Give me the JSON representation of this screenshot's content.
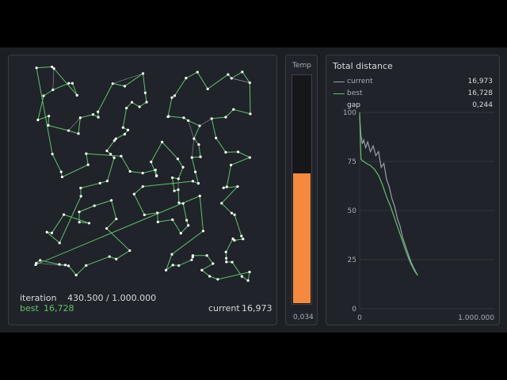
{
  "tsp": {
    "iteration_label": "iteration",
    "iteration_value": "430.500 / 1.000.000",
    "best_label": "best",
    "best_value": "16,728",
    "current_label": "current",
    "current_value": "16,973",
    "route_color": "#5fc36c",
    "alt_route_color": "#9aa0a8"
  },
  "temperature": {
    "title": "Temp",
    "value_label": "0,034",
    "level_percent": 57,
    "fill_color": "#f68a3c"
  },
  "distance": {
    "title": "Total distance",
    "legend": [
      {
        "name": "current",
        "value": "16,973",
        "color": "#9aa0a8"
      },
      {
        "name": "best",
        "value": "16,728",
        "color": "#5fc36c"
      },
      {
        "name": "gap",
        "value": "0,244",
        "color": ""
      }
    ]
  },
  "chart_data": {
    "type": "line",
    "ylim": [
      0,
      100
    ],
    "xlim": [
      0,
      1000000
    ],
    "y_ticks": [
      "0",
      "25",
      "50",
      "75",
      "100"
    ],
    "x_ticks": [
      "0",
      "1.000.000"
    ],
    "grid": true,
    "series": [
      {
        "name": "current",
        "color": "#9aa0a8",
        "x": [
          0,
          10000,
          20000,
          30000,
          45000,
          60000,
          80000,
          100000,
          120000,
          140000,
          160000,
          180000,
          200000,
          220000,
          240000,
          260000,
          280000,
          300000,
          320000,
          340000,
          360000,
          380000,
          400000,
          415000,
          430500
        ],
        "y": [
          98,
          88,
          84,
          86,
          82,
          85,
          80,
          83,
          78,
          80,
          72,
          74,
          66,
          62,
          56,
          52,
          46,
          42,
          36,
          32,
          28,
          24,
          21,
          19,
          17
        ]
      },
      {
        "name": "best",
        "color": "#5fc36c",
        "x": [
          0,
          10000,
          30000,
          50000,
          80000,
          110000,
          140000,
          170000,
          200000,
          230000,
          260000,
          290000,
          320000,
          350000,
          380000,
          410000,
          430500
        ],
        "y": [
          100,
          76,
          75,
          74,
          73,
          71,
          68,
          63,
          57,
          52,
          46,
          40,
          34,
          28,
          23,
          19,
          17
        ]
      }
    ]
  }
}
